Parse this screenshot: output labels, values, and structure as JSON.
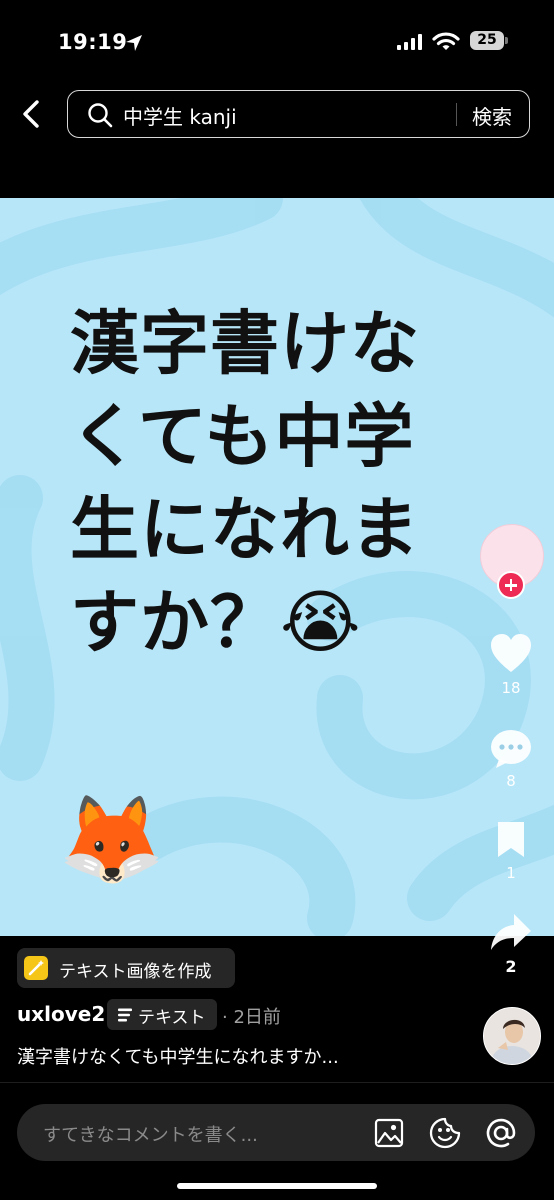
{
  "status_bar": {
    "time": "19:19",
    "battery": "25"
  },
  "search": {
    "query": "中学生 kanji",
    "button_label": "検索"
  },
  "content": {
    "text_lines": [
      "漢字書けな",
      "くても中学",
      "生になれま",
      "すか？😭"
    ],
    "sticker": "🦊",
    "background": "#b6e6f8"
  },
  "actions": {
    "likes": "18",
    "comments": "8",
    "bookmarks": "1",
    "shares": "2",
    "accent": "#ee2b54"
  },
  "post": {
    "banner_label": "テキスト画像を作成",
    "username": "uxlove2",
    "type_label": "テキスト",
    "date": "· 2日前",
    "caption": "漢字書けなくても中学生になれますか..."
  },
  "comment_bar": {
    "placeholder": "すてきなコメントを書く..."
  }
}
